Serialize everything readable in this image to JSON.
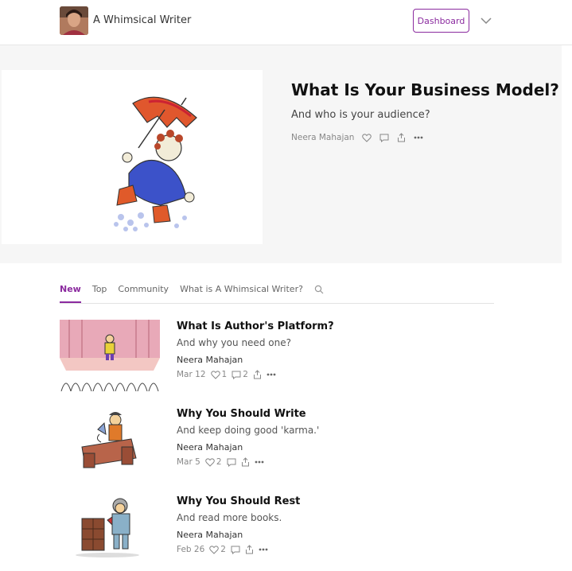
{
  "header": {
    "publication_name": "A Whimsical Writer",
    "dashboard_label": "Dashboard"
  },
  "hero": {
    "title": "What Is Your Business Model?",
    "subtitle": "And who is your audience?",
    "author": "Neera Mahajan"
  },
  "tabs": [
    {
      "label": "New",
      "active": true
    },
    {
      "label": "Top",
      "active": false
    },
    {
      "label": "Community",
      "active": false
    },
    {
      "label": "What is A Whimsical Writer?",
      "active": false
    }
  ],
  "posts": [
    {
      "title": "What Is Author's Platform?",
      "subtitle": "And why you need one?",
      "author": "Neera Mahajan",
      "date": "Mar 12",
      "likes": "1",
      "comments": "2"
    },
    {
      "title": "Why You Should Write",
      "subtitle": "And keep doing good 'karma.'",
      "author": "Neera Mahajan",
      "date": "Mar 5",
      "likes": "2",
      "comments": ""
    },
    {
      "title": "Why You Should Rest",
      "subtitle": "And read more books.",
      "author": "Neera Mahajan",
      "date": "Feb 26",
      "likes": "2",
      "comments": ""
    }
  ],
  "colors": {
    "accent": "#8b2b9f",
    "hero_bg": "#f6f6f6"
  }
}
